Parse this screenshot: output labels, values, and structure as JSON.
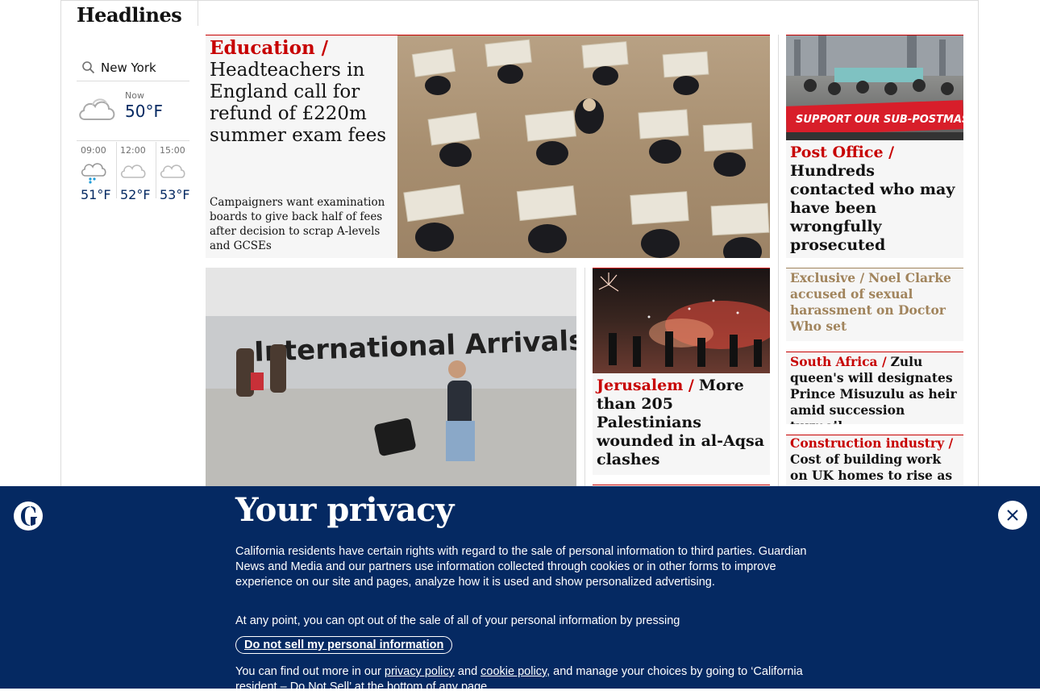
{
  "section": {
    "title": "Headlines"
  },
  "weather": {
    "location": "New York",
    "now_label": "Now",
    "now_temp": "50°F",
    "forecast": [
      {
        "time": "09:00",
        "temp": "51°F",
        "icon": "rain-cloud-icon"
      },
      {
        "time": "12:00",
        "temp": "52°F",
        "icon": "cloud-icon"
      },
      {
        "time": "15:00",
        "temp": "53°F",
        "icon": "cloud-icon"
      }
    ]
  },
  "main_story": {
    "kicker": "Education /",
    "headline": "Headteachers in England call for refund of £220m summer exam fees",
    "standfirst": "Campaigners want examination boards to give back half of fees after decision to scrap A-levels and GCSEs"
  },
  "right_story": {
    "kicker": "Post Office /",
    "headline": "Hundreds contacted who may have been wrongfully prosecuted",
    "banner_text": "SUPPORT OUR SUB-POSTMASTERS"
  },
  "arrivals_story": {
    "sign_text": "International Arrivals"
  },
  "jerusalem_story": {
    "kicker": "Jerusalem /",
    "headline": "More than 205 Palestinians wounded in al-Aqsa clashes"
  },
  "small_stories": [
    {
      "kicker": "Exclusive /",
      "headline": "Noel Clarke accused of sexual harassment on Doctor Who set",
      "kicker_color": "#a1845c"
    },
    {
      "kicker": "South Africa /",
      "headline": "Zulu queen's will designates Prince Misuzulu as heir amid succession turmoil",
      "kicker_color": "#c70000"
    },
    {
      "kicker": "Construction industry /",
      "headline": "Cost of building work on UK homes to rise as price of",
      "kicker_color": "#c70000"
    }
  ],
  "privacy": {
    "title": "Your privacy",
    "para1": "California residents have certain rights with regard to the sale of personal information to third parties. Guardian News and Media and our partners use information collected through cookies or in other forms to improve experience on our site and pages, analyze how it is used and show personalized advertising.",
    "para2": "At any point, you can opt out of the sale of all of your personal information by pressing",
    "dns_button": "Do not sell my personal information",
    "para3_a": "You can find out more in our ",
    "privacy_link": "privacy policy",
    "para3_b": " and ",
    "cookie_link": "cookie policy",
    "para3_c": ", and manage your choices by going to ‘California resident – Do Not Sell’ at the bottom of any page."
  },
  "colors": {
    "brand_blue": "#052962",
    "news_red": "#c70000",
    "card_bg": "#f6f6f6"
  }
}
